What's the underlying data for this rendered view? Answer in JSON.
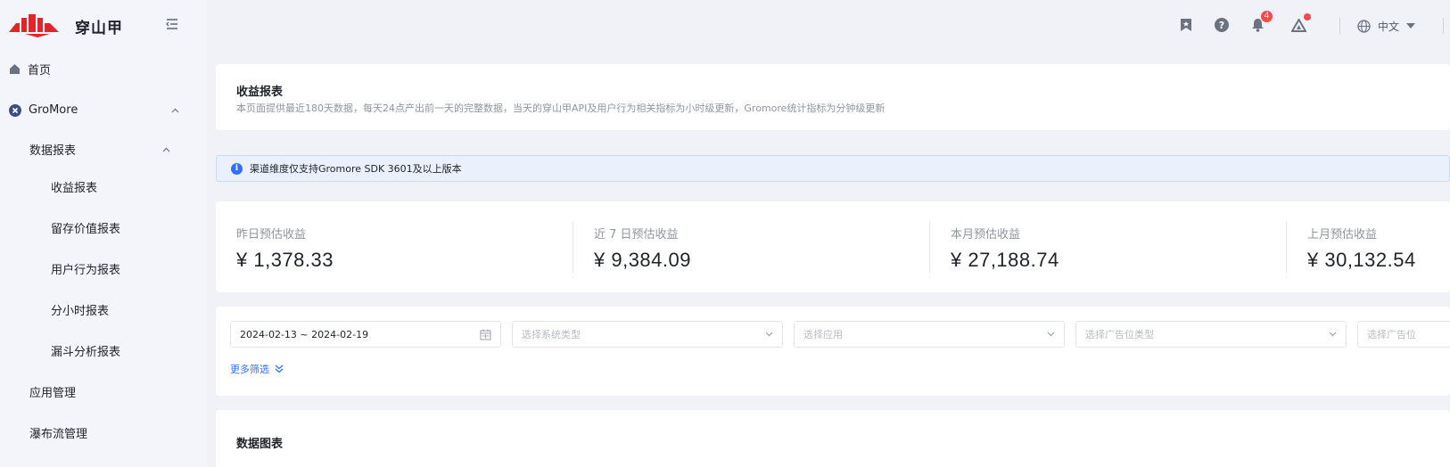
{
  "brand": {
    "name": "穿山甲",
    "logo_color": "#e0262b"
  },
  "sidebar": {
    "items": [
      {
        "label": "首页",
        "icon": "home-icon"
      },
      {
        "label": "GroMore",
        "icon": "gromore-icon"
      },
      {
        "label": "数据报表"
      },
      {
        "label": "收益报表"
      },
      {
        "label": "留存价值报表"
      },
      {
        "label": "用户行为报表"
      },
      {
        "label": "分小时报表"
      },
      {
        "label": "漏斗分析报表"
      },
      {
        "label": "应用管理"
      },
      {
        "label": "瀑布流管理"
      }
    ]
  },
  "header": {
    "notification_count": "4",
    "language": "中文"
  },
  "page": {
    "title": "收益报表",
    "description": "本页面提供最近180天数据，每天24点产出前一天的完整数据，当天的穿山甲API及用户行为相关指标为小时级更新，Gromore统计指标为分钟级更新"
  },
  "alert": {
    "text": "渠道维度仅支持Gromore SDK 3601及以上版本"
  },
  "stats": [
    {
      "label": "昨日预估收益",
      "value": "¥ 1,378.33"
    },
    {
      "label": "近 7 日预估收益",
      "value": "¥ 9,384.09"
    },
    {
      "label": "本月预估收益",
      "value": "¥ 27,188.74"
    },
    {
      "label": "上月预估收益",
      "value": "¥ 30,132.54"
    }
  ],
  "filters": {
    "date_range": "2024-02-13 ~ 2024-02-19",
    "system_type_placeholder": "选择系统类型",
    "app_placeholder": "选择应用",
    "ad_slot_type_placeholder": "选择广告位类型",
    "ad_slot_placeholder": "选择广告位",
    "more_label": "更多筛选"
  },
  "chart_section": {
    "title": "数据图表"
  },
  "colors": {
    "accent": "#3370ff",
    "badge": "#f54a45"
  }
}
